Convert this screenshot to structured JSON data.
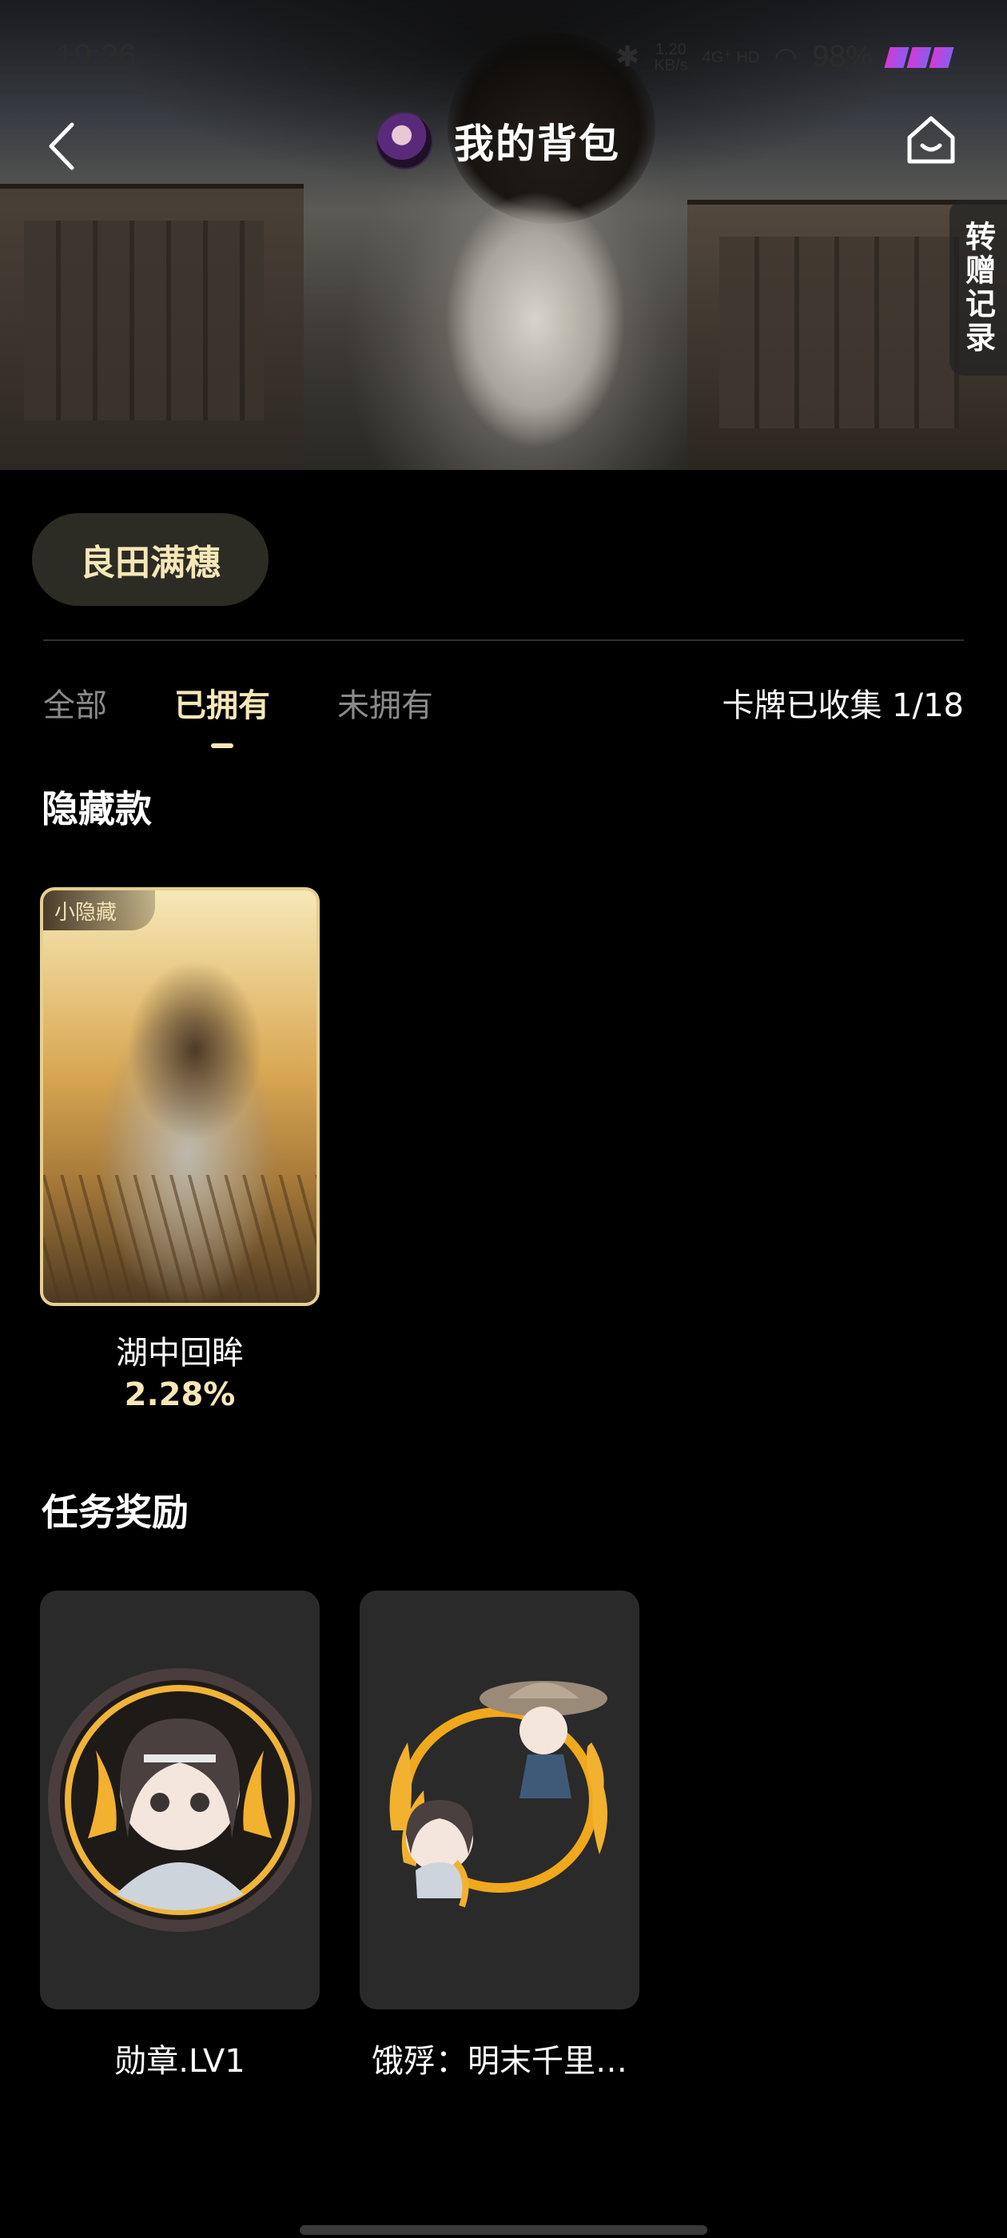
{
  "status_bar": {
    "time": "19:26",
    "net_speed_value": "1.20",
    "net_speed_unit": "KB/s",
    "network_type": "4G⁺ HD",
    "battery": "98%"
  },
  "header": {
    "title": "我的背包",
    "gift_record": "转赠记录"
  },
  "series": {
    "name": "良田满穗"
  },
  "tabs": [
    {
      "label": "全部",
      "active": false
    },
    {
      "label": "已拥有",
      "active": true
    },
    {
      "label": "未拥有",
      "active": false
    }
  ],
  "collection": {
    "text": "卡牌已收集 1/18"
  },
  "sections": {
    "hidden": {
      "title": "隐藏款",
      "cards": [
        {
          "badge": "小隐藏",
          "name": "湖中回眸",
          "rate": "2.28%"
        }
      ]
    },
    "rewards": {
      "title": "任务奖励",
      "items": [
        {
          "name": "勋章.LV1"
        },
        {
          "name": "饿殍：明末千里…"
        }
      ]
    }
  },
  "colors": {
    "accent_gold": "#f6e7b7",
    "pill_bg": "#2c2b24",
    "tile_bg": "#2a2a2a",
    "card_border": "#e6cf91"
  }
}
